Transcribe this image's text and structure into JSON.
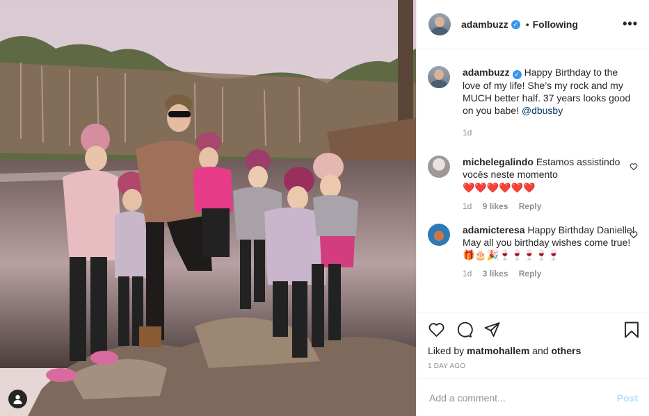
{
  "post": {
    "author": "adambuzz",
    "follow_dot": "•",
    "follow_label": "Following",
    "more_icon": "more-horizontal-icon"
  },
  "caption": {
    "author": "adambuzz",
    "text": "Happy Birthday to the love of my life! She’s my rock and my MUCH better half. 37 years looks good on you babe! ",
    "mention": "@dbusby",
    "time": "1d"
  },
  "comments": [
    {
      "author": "michelegalindo",
      "text": "Estamos assistindo vocês neste momento",
      "emoji": "❤️❤️❤️❤️❤️❤️",
      "time": "1d",
      "likes": "9 likes",
      "reply": "Reply"
    },
    {
      "author": "adamicteresa",
      "text": "Happy Birthday Danielle! May all you birthday wishes come true!",
      "emoji": "🎁🎂🎉🍷🍷🍷🍷🍷",
      "time": "1d",
      "likes": "3 likes",
      "reply": "Reply"
    }
  ],
  "actions": {
    "liked_by_prefix": "Liked by ",
    "liked_by_user": "matmohallem",
    "liked_by_and": " and ",
    "liked_by_others": "others",
    "time_ago": "1 DAY AGO"
  },
  "add_comment": {
    "placeholder": "Add a comment...",
    "post_label": "Post"
  },
  "colors": {
    "link": "#00376b",
    "verified": "#3897f0",
    "post_disabled": "#b2dffc",
    "muted": "#8e8e8e"
  }
}
